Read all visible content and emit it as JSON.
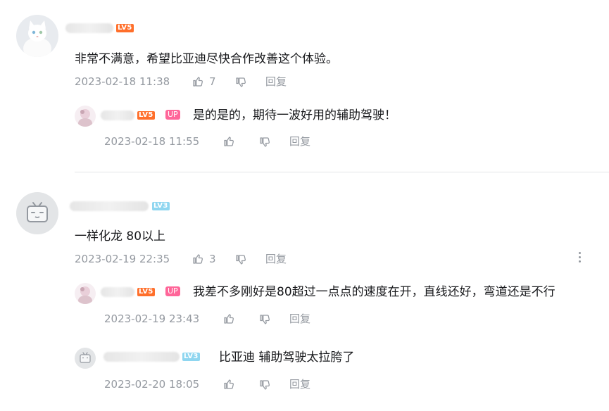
{
  "comments": [
    {
      "level": "LV5",
      "text": "非常不满意，希望比亚迪尽快合作改善这个体验。",
      "time": "2023-02-18 11:38",
      "likes": "7",
      "reply_label": "回复",
      "replies": [
        {
          "level": "LV5",
          "badge": "UP",
          "text": "是的是的，期待一波好用的辅助驾驶！",
          "time": "2023-02-18 11:55",
          "reply_label": "回复"
        }
      ]
    },
    {
      "level": "LV3",
      "text": "一样化龙 80以上",
      "time": "2023-02-19 22:35",
      "likes": "3",
      "reply_label": "回复",
      "replies": [
        {
          "level": "LV5",
          "badge": "UP",
          "text": "我差不多刚好是80超过一点点的速度在开，直线还好，弯道还是不行",
          "time": "2023-02-19 23:43",
          "reply_label": "回复"
        },
        {
          "level": "LV3",
          "text": "比亚迪 辅助驾驶太拉胯了",
          "time": "2023-02-20 18:05",
          "reply_label": "回复"
        }
      ]
    }
  ],
  "icons": [
    "like-icon",
    "dislike-icon",
    "more-icon"
  ],
  "colors": {
    "lv5": "#ff6f2b",
    "lv3": "#8fd6f0",
    "up_badge": "#ff6699",
    "meta": "#9499a0",
    "text": "#18191c"
  }
}
